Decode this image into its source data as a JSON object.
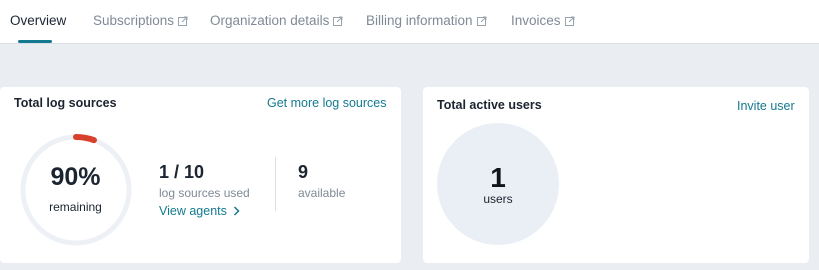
{
  "tabs": [
    {
      "label": "Overview",
      "active": true,
      "external": false
    },
    {
      "label": "Subscriptions",
      "active": false,
      "external": true
    },
    {
      "label": "Organization details",
      "active": false,
      "external": true
    },
    {
      "label": "Billing information",
      "active": false,
      "external": true
    },
    {
      "label": "Invoices",
      "active": false,
      "external": true
    }
  ],
  "log_sources": {
    "title": "Total log sources",
    "link": "Get more log sources",
    "percent_remaining": 0.9,
    "percent_label": "90%",
    "percent_caption": "remaining",
    "used_value": "1 / 10",
    "used_caption": "log sources used",
    "view_agents": "View agents",
    "available_value": "9",
    "available_caption": "available"
  },
  "active_users": {
    "title": "Total active users",
    "link": "Invite user",
    "count": "1",
    "count_caption": "users"
  },
  "colors": {
    "accent": "#137a8f",
    "donut_used": "#d7402b",
    "donut_track": "#edf1f6",
    "page_bg": "#eaeef2"
  }
}
